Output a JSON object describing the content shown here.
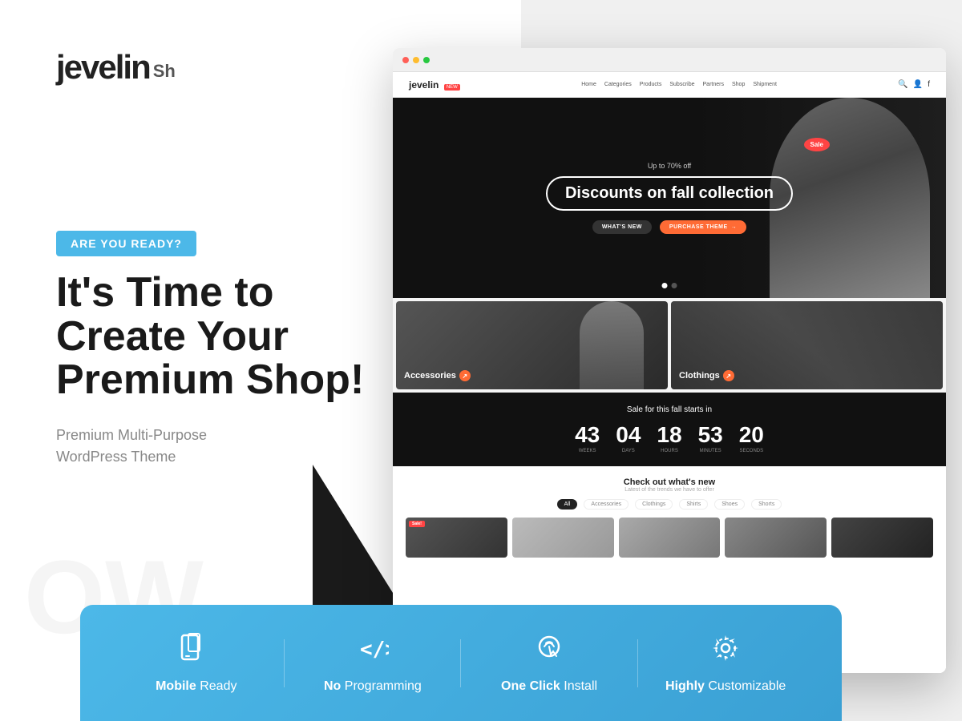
{
  "left": {
    "logo": "jevelin",
    "logo_sup": "Sh",
    "watermark": "OW",
    "ready_badge": "ARE YOU READY?",
    "headline": "It's Time to Create Your Premium Shop!",
    "subheadline_line1": "Premium Multi-Purpose",
    "subheadline_line2": "WordPress Theme"
  },
  "browser": {
    "site_logo": "jevelin",
    "site_logo_badge": "NEW",
    "nav_items": [
      "Home",
      "Categories",
      "Products",
      "Subscribe",
      "Partners",
      "Shop",
      "Shipment"
    ],
    "hero": {
      "discount_text": "Up to 70% off",
      "title": "Discounts on fall collection",
      "sale_badge": "Sale",
      "btn_whats_new": "WHAT'S NEW",
      "btn_purchase": "PURCHASE THEME"
    },
    "categories": [
      {
        "label": "Accessories",
        "type": "accessories"
      },
      {
        "label": "Clothings",
        "type": "clothings"
      }
    ],
    "countdown": {
      "title": "Sale for this fall starts in",
      "weeks": "43",
      "days": "04",
      "hours": "18",
      "minutes": "53",
      "seconds": "20",
      "weeks_label": "WEEKS",
      "days_label": "DAYS",
      "hours_label": "HOURS",
      "minutes_label": "MINUTES",
      "seconds_label": "SECONDS"
    },
    "new_arrivals": {
      "title": "Check out what's new",
      "subtitle": "Latest of the trends we have to offer",
      "filters": [
        "All",
        "Accessories",
        "Clothings",
        "Shirts",
        "Shoes",
        "Shorts"
      ]
    }
  },
  "feature_bar": {
    "items": [
      {
        "icon": "📱",
        "label_bold": "Mobile",
        "label_rest": " Ready"
      },
      {
        "icon": "</>",
        "label_bold": "No",
        "label_rest": " Programming"
      },
      {
        "icon": "👆",
        "label_bold": "One Click",
        "label_rest": " Install"
      },
      {
        "icon": "⚙",
        "label_bold": "Highly",
        "label_rest": " Customizable"
      }
    ]
  }
}
